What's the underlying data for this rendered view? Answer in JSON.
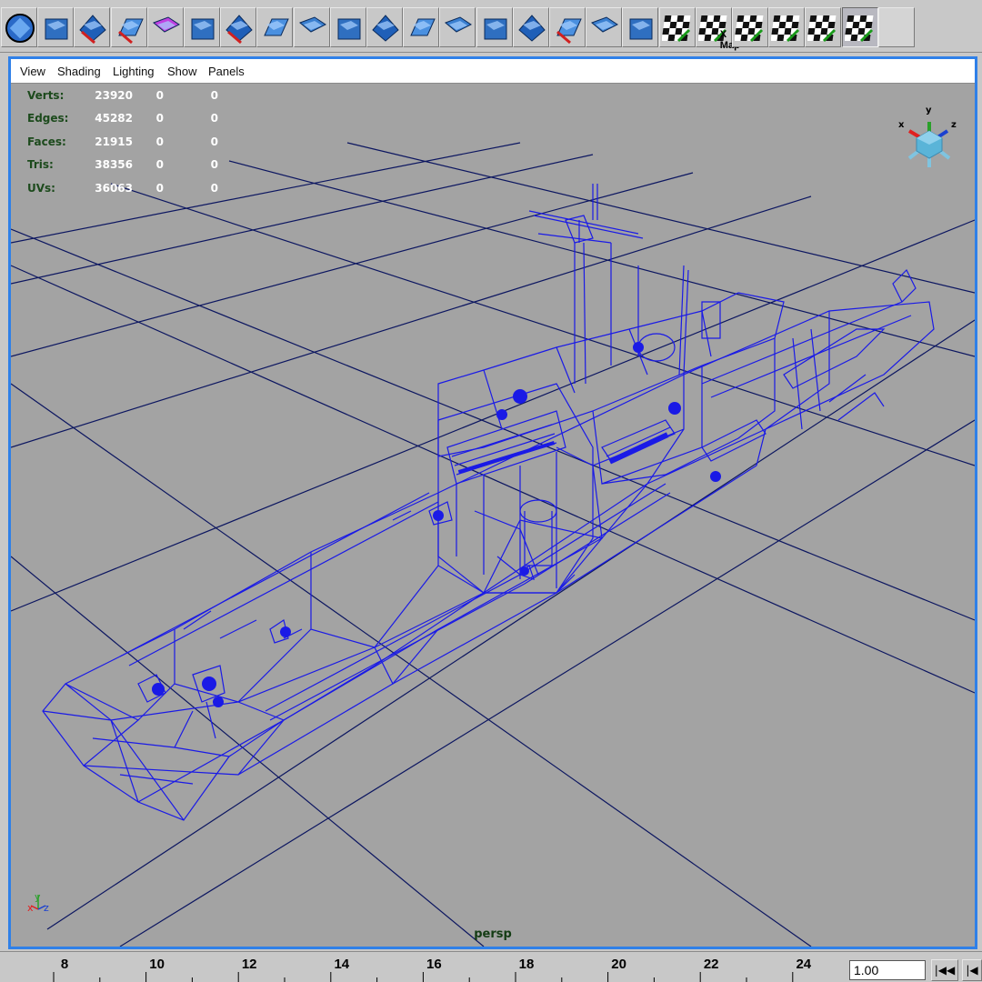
{
  "shelf": {
    "items": [
      {
        "icon": "selection-mask-icon",
        "label": ""
      },
      {
        "icon": "poly-cubes-icon",
        "label": ""
      },
      {
        "icon": "poly-sphere-extract-icon",
        "label": ""
      },
      {
        "icon": "poly-sphere-combine-icon",
        "label": ""
      },
      {
        "icon": "poly-cube-select-icon",
        "label": ""
      },
      {
        "icon": "split-polygon-icon",
        "label": ""
      },
      {
        "icon": "cut-faces-icon",
        "label": ""
      },
      {
        "icon": "extrude-face-icon",
        "label": ""
      },
      {
        "icon": "extrude-edge-icon",
        "label": ""
      },
      {
        "icon": "bevel-icon",
        "label": ""
      },
      {
        "icon": "smooth-icon",
        "label": ""
      },
      {
        "icon": "bridge-faces-icon",
        "label": ""
      },
      {
        "icon": "merge-vertices-icon",
        "label": ""
      },
      {
        "icon": "collapse-edge-icon",
        "label": ""
      },
      {
        "icon": "append-polygon-icon",
        "label": ""
      },
      {
        "icon": "subdivide-face-icon",
        "label": ""
      },
      {
        "icon": "duplicate-face-icon",
        "label": ""
      },
      {
        "icon": "planar-mapping-icon",
        "label": ""
      },
      {
        "icon": "checker-uv-icon",
        "label": ""
      },
      {
        "icon": "automatic-mapping-icon",
        "label": "X Map"
      },
      {
        "icon": "cylindrical-mapping-icon",
        "label": ""
      },
      {
        "icon": "spherical-mapping-icon",
        "label": ""
      },
      {
        "icon": "uv-texture-editor-icon",
        "label": ""
      },
      {
        "icon": "uv-snapshot-icon",
        "label": ""
      },
      {
        "icon": "blank-shelf-icon",
        "label": ""
      }
    ]
  },
  "panel": {
    "menus": [
      "View",
      "Shading",
      "Lighting",
      "Show",
      "Panels"
    ],
    "camera": "persp",
    "hud": [
      {
        "label": "Verts:",
        "v1": "23920",
        "v2": "0",
        "v3": "0"
      },
      {
        "label": "Edges:",
        "v1": "45282",
        "v2": "0",
        "v3": "0"
      },
      {
        "label": "Faces:",
        "v1": "21915",
        "v2": "0",
        "v3": "0"
      },
      {
        "label": "Tris:",
        "v1": "38356",
        "v2": "0",
        "v3": "0"
      },
      {
        "label": "UVs:",
        "v1": "36063",
        "v2": "0",
        "v3": "0"
      }
    ],
    "view_cube_axes": {
      "x": "x",
      "y": "y",
      "z": "z"
    },
    "origin_axes": {
      "x": "x",
      "y": "y",
      "z": "z"
    }
  },
  "timeline": {
    "ticks": [
      "8",
      "10",
      "12",
      "14",
      "16",
      "18",
      "20",
      "22",
      "24"
    ],
    "current_time": "1.00",
    "step_back_icon": "step-back-icon",
    "step_back2_icon": "go-to-start-icon"
  },
  "colors": {
    "wireframe": "#1a1ae6",
    "grid": "#0c1660",
    "viewport_bg": "#a3a3a3",
    "panel_border": "#2f80e8",
    "hud_label": "#1c4a1c"
  }
}
